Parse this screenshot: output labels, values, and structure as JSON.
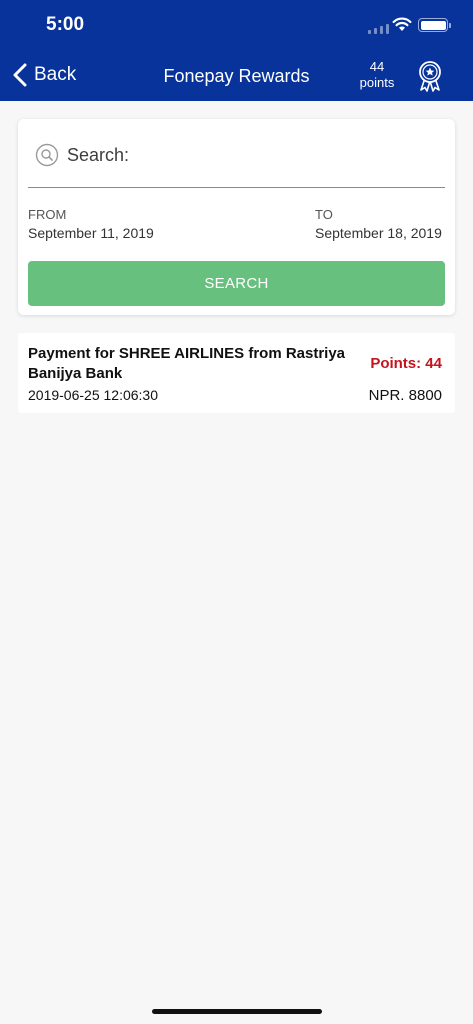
{
  "status_bar": {
    "time": "5:00"
  },
  "nav": {
    "back_label": "Back",
    "title": "Fonepay Rewards",
    "points_value": "44",
    "points_unit": "points"
  },
  "search": {
    "placeholder": "Search:",
    "value": "",
    "from_label": "FROM",
    "from_date": "September 11, 2019",
    "to_label": "TO",
    "to_date": "September 18, 2019",
    "button_label": "SEARCH"
  },
  "transactions": [
    {
      "description": "Payment for SHREE AIRLINES from Rastriya Banijya Bank",
      "datetime": "2019-06-25 12:06:30",
      "points": "Points: 44",
      "amount": "NPR. 8800"
    }
  ],
  "colors": {
    "header": "#07339b",
    "button": "#67c07d",
    "points_text": "#c4141d"
  },
  "icons": [
    "chevron-left-icon",
    "award-badge-icon",
    "search-icon",
    "wifi-icon",
    "battery-icon",
    "signal-icon"
  ]
}
